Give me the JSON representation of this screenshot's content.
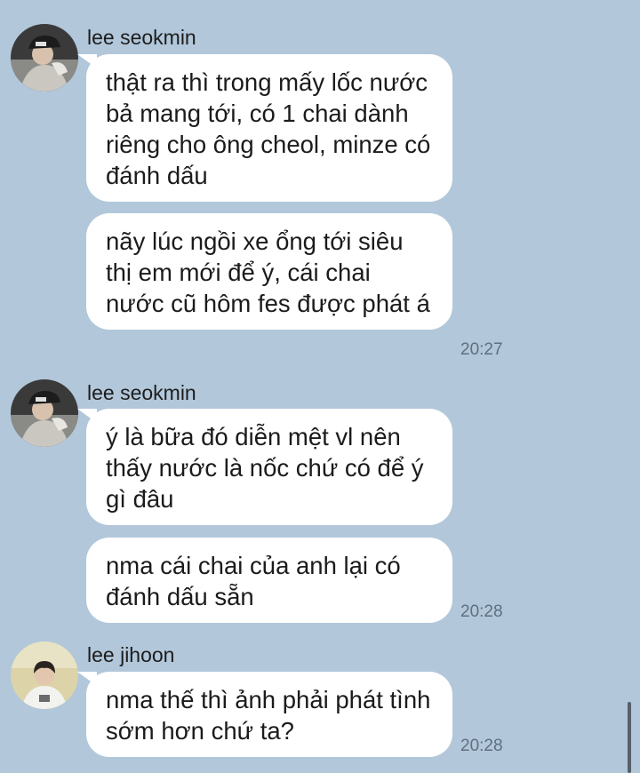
{
  "groups": [
    {
      "sender": "lee seokmin",
      "avatar_icon": "profile-photo-cap-icon",
      "messages": [
        "thật ra thì trong mấy lốc nước bả mang tới, có 1 chai dành riêng cho ông cheol, minze có đánh dấu",
        "nãy lúc ngồi xe ổng tới siêu thị em mới để ý, cái chai nước cũ hôm fes được phát á"
      ],
      "time": "20:27"
    },
    {
      "sender": "lee seokmin",
      "avatar_icon": "profile-photo-cap-icon",
      "messages": [
        "ý là bữa đó diễn mệt vl nên thấy nước là nốc chứ có để ý gì đâu",
        "nma cái chai của anh lại có đánh dấu sẵn"
      ],
      "time": "20:28"
    },
    {
      "sender": "lee jihoon",
      "avatar_icon": "profile-photo-icon",
      "messages": [
        "nma thế thì ảnh phải phát tình sớm hơn chứ ta?"
      ],
      "time": "20:28"
    }
  ],
  "colors": {
    "background": "#b2c7da",
    "bubble": "#ffffff",
    "timestamp": "#5f6f7f"
  }
}
